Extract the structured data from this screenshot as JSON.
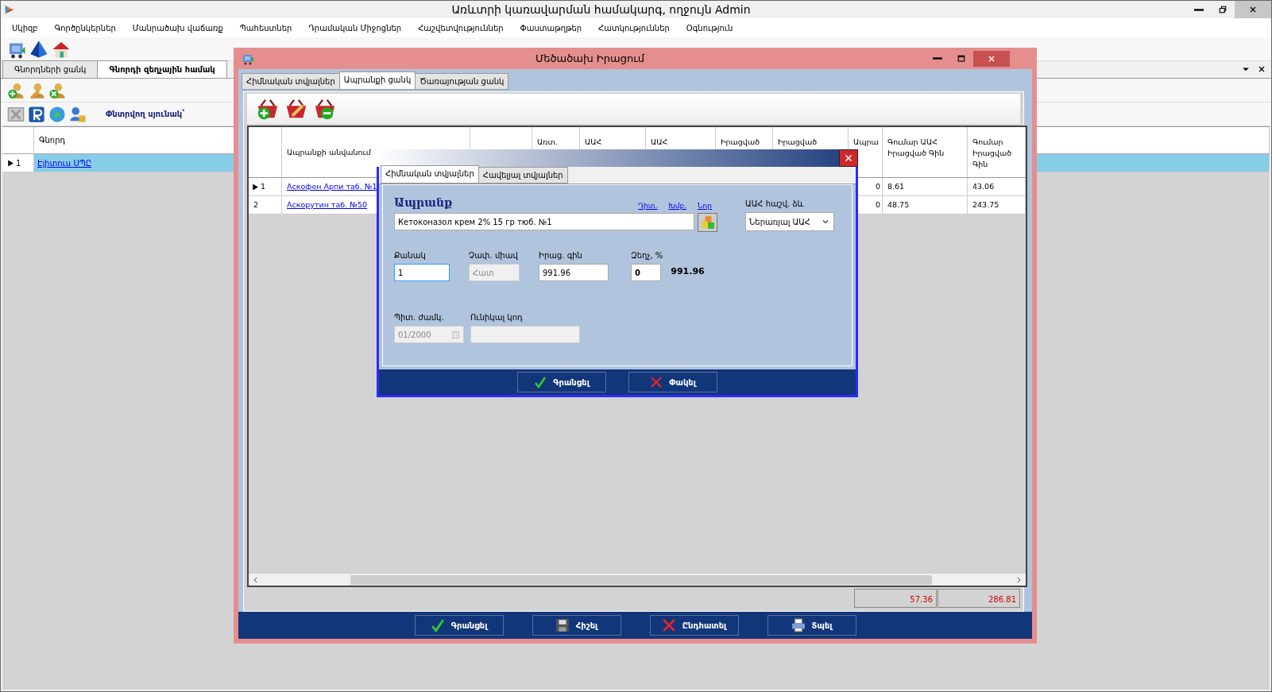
{
  "window": {
    "title": "Առևտրի կառավարման համակարգ, ողջույն Admin"
  },
  "menu": [
    "Սկիզբ",
    "Գործընկերներ",
    "Մանրածախ վաճառք",
    "Պահեստներ",
    "Դրամական Միջոցներ",
    "Հաշվետվություններ",
    "Փաստաթղթեր",
    "Հատկություններ",
    "Օգնություն"
  ],
  "doc_tabs": [
    {
      "label": "Գնորդների ցանկ",
      "selected": false
    },
    {
      "label": "Գնորդի զեղչային համակ",
      "selected": true
    }
  ],
  "search_label": "Փնտրվող սյունակ՝",
  "customers": {
    "columns": [
      "Գնորդ"
    ],
    "rows": [
      {
        "marker": "1",
        "current": true,
        "name": "Էլիտուս ՍՊԸ",
        "selected": true
      }
    ]
  },
  "sale_window": {
    "title": "Մեծածախ Իրացում",
    "tabs": [
      {
        "label": "Հիմնական տվյալներ",
        "selected": false
      },
      {
        "label": "Ապրանքի ցանկ",
        "selected": true
      },
      {
        "label": "Ծառայության ցանկ",
        "selected": false
      }
    ],
    "table": {
      "columns": [
        "Ապրանքի անվանում",
        "",
        "Առտ.",
        "ԱԱՀ",
        "ԱԱՀ",
        "Իրացված",
        "Իրացված",
        "Ապրա",
        "Գումար ԱԱՀ Իրացված Գին",
        "Գումար Իրացված Գին"
      ],
      "rows": [
        {
          "marker": "1",
          "current": true,
          "name": "Аскофен Арпи таб. №1",
          "column_8": "0",
          "vat_sum": "8.61",
          "sum": "43.06"
        },
        {
          "marker": "2",
          "current": false,
          "name": "Аскорутин таб. №50",
          "column_8": "0",
          "vat_sum": "48.75",
          "sum": "243.75"
        }
      ]
    },
    "totals": [
      "57.36",
      "286.81"
    ],
    "buttons": [
      {
        "label": "Գրանցել",
        "kind": "check"
      },
      {
        "label": "Հիշել",
        "kind": "save"
      },
      {
        "label": "Ընդհատել",
        "kind": "cancel"
      },
      {
        "label": "Տպել",
        "kind": "print"
      }
    ]
  },
  "item_dialog": {
    "tabs": [
      {
        "label": "Հիմնական տվյալներ",
        "selected": true
      },
      {
        "label": "Հավելյալ տվյալներ",
        "selected": false
      }
    ],
    "product_label": "Ապրանք",
    "links": [
      "Դիտ.",
      "Խմբ.",
      "Նոր"
    ],
    "product": {
      "value": "Кетоконазол крем 2% 15 гр тюб. №1"
    },
    "vat_label": "ԱԱՀ հաշվ. ձև",
    "vat_select": {
      "value": "Ներառյալ ԱԱՀ"
    },
    "fields": [
      {
        "label": "Քանակ",
        "value": "1",
        "disabled": false,
        "focused": true
      },
      {
        "label": "Չափ. միավ",
        "value": "Հատ",
        "disabled": true,
        "focused": false
      },
      {
        "label": "Իրաց. գին",
        "value": "991.96",
        "disabled": false,
        "focused": false
      },
      {
        "label": "Զեղչ, %",
        "value": "0",
        "disabled": false,
        "focused": false
      }
    ],
    "total": "991.96",
    "expiry": {
      "label": "Պիտ. ժամկ.",
      "value": "01/2000",
      "disabled": true
    },
    "unique_code": {
      "label": "Ունիկալ կոդ",
      "disabled": true
    },
    "buttons": [
      {
        "label": "Գրանցել",
        "kind": "check"
      },
      {
        "label": "Փակել",
        "kind": "close"
      }
    ]
  }
}
